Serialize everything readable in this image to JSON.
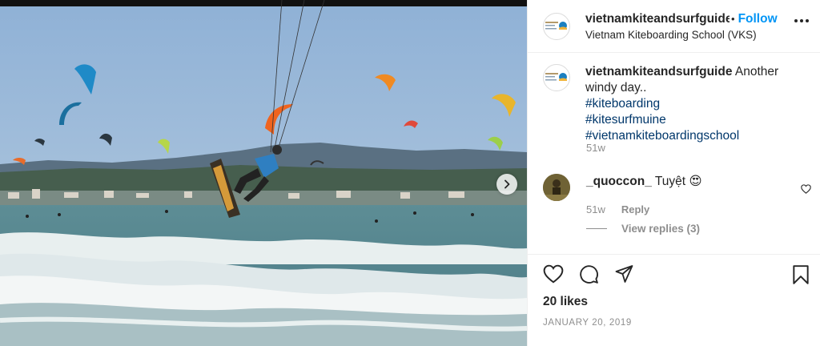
{
  "post": {
    "username": "vietnamkiteandsurfguide",
    "follow_dot": "•",
    "follow_label": "Follow",
    "location": "Vietnam Kiteboarding School (VKS)",
    "photo_alt": "Kitesurfer jumping above the waves with many kites in the sky",
    "avatar_icon": "vks-logo-icon",
    "more_icon": "more-options-icon",
    "next_icon": "chevron-right-icon"
  },
  "caption": {
    "username": "vietnamkiteandsurfguide",
    "text": "Another windy day..",
    "tags": [
      "#kiteboarding",
      "#kitesurfmuine",
      "#vietnamkiteboardingschool"
    ],
    "time": "51w"
  },
  "comments": [
    {
      "username": "_quoccon_",
      "text": "Tuyệt",
      "emoji": "😍",
      "time": "51w",
      "reply_label": "Reply",
      "view_replies": "View replies (3)"
    }
  ],
  "actions": {
    "like_icon": "heart-icon",
    "comment_icon": "comment-icon",
    "share_icon": "share-icon",
    "save_icon": "bookmark-icon"
  },
  "likes_text": "20 likes",
  "date_text": "JANUARY 20, 2019",
  "colors": {
    "link_blue": "#0095f6",
    "hashtag": "#00376b",
    "secondary_text": "#8e8e8e",
    "primary_text": "#262626"
  }
}
